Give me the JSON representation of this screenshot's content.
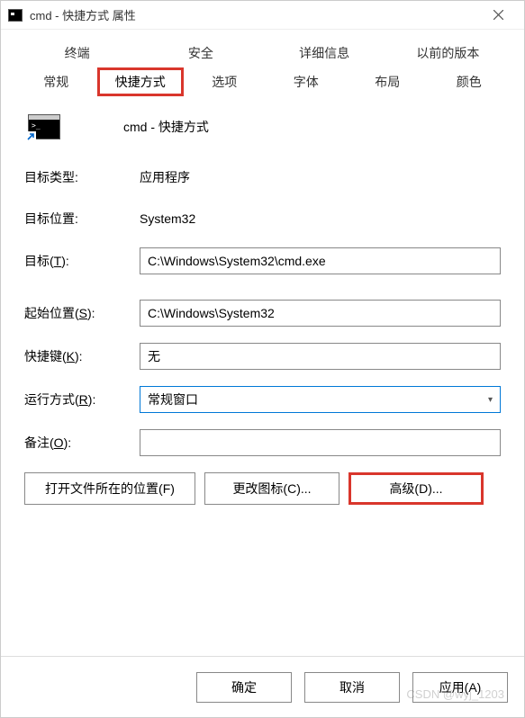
{
  "window": {
    "title": "cmd - 快捷方式 属性"
  },
  "tabs": {
    "row1": [
      "终端",
      "安全",
      "详细信息",
      "以前的版本"
    ],
    "row2": [
      "常规",
      "快捷方式",
      "选项",
      "字体",
      "布局",
      "颜色"
    ],
    "active": "快捷方式"
  },
  "shortcut": {
    "name": "cmd - 快捷方式",
    "target_type_label": "目标类型:",
    "target_type": "应用程序",
    "target_location_label": "目标位置:",
    "target_location": "System32",
    "target_label": "目标(T):",
    "target_label_u": "T",
    "target": "C:\\Windows\\System32\\cmd.exe",
    "start_in_label": "起始位置(S):",
    "start_in_label_u": "S",
    "start_in": "C:\\Windows\\System32",
    "shortcut_key_label": "快捷键(K):",
    "shortcut_key_label_u": "K",
    "shortcut_key": "无",
    "run_label": "运行方式(R):",
    "run_label_u": "R",
    "run": "常规窗口",
    "comment_label": "备注(O):",
    "comment_label_u": "O",
    "comment": ""
  },
  "buttons": {
    "open_location": "打开文件所在的位置(F)",
    "change_icon": "更改图标(C)...",
    "advanced": "高级(D)...",
    "ok": "确定",
    "cancel": "取消",
    "apply": "应用(A)"
  },
  "watermark": "CSDN @wyj_1203"
}
